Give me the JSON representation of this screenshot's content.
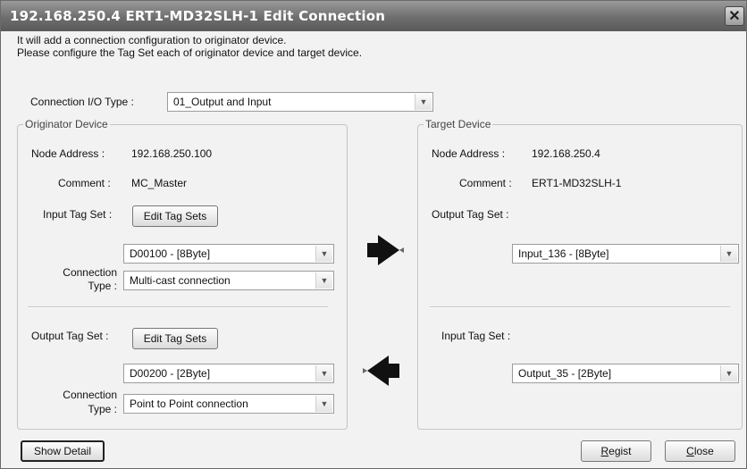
{
  "window": {
    "title": "192.168.250.4 ERT1-MD32SLH-1 Edit Connection"
  },
  "intro": {
    "line1": "It will add a connection configuration to originator device.",
    "line2": "Please configure the Tag Set each of originator device and target device."
  },
  "connection_io_type": {
    "label": "Connection I/O Type :",
    "value": "01_Output and Input"
  },
  "originator": {
    "legend": "Originator Device",
    "node_address_label": "Node Address :",
    "node_address": "192.168.250.100",
    "comment_label": "Comment :",
    "comment": "MC_Master",
    "input_tag_set_label": "Input Tag Set :",
    "edit_tag_sets_1": "Edit Tag Sets",
    "input_tag_value": "D00100 - [8Byte]",
    "connection_type_label_1": "Connection",
    "connection_type_label_2": "Type :",
    "input_connection_type": "Multi-cast connection",
    "output_tag_set_label": "Output Tag Set :",
    "edit_tag_sets_2": "Edit Tag Sets",
    "output_tag_value": "D00200 - [2Byte]",
    "output_connection_type": "Point to Point connection"
  },
  "target": {
    "legend": "Target Device",
    "node_address_label": "Node Address :",
    "node_address": "192.168.250.4",
    "comment_label": "Comment :",
    "comment": "ERT1-MD32SLH-1",
    "output_tag_set_label": "Output Tag Set :",
    "output_tag_value": "Input_136 - [8Byte]",
    "input_tag_set_label": "Input Tag Set :",
    "input_tag_value": "Output_35 - [2Byte]"
  },
  "buttons": {
    "show_detail": "Show Detail",
    "regist_first": "R",
    "regist_rest": "egist",
    "close_first": "C",
    "close_rest": "lose"
  },
  "icons": {
    "arrow_right": "arrow-right-icon",
    "arrow_left": "arrow-left-icon"
  }
}
